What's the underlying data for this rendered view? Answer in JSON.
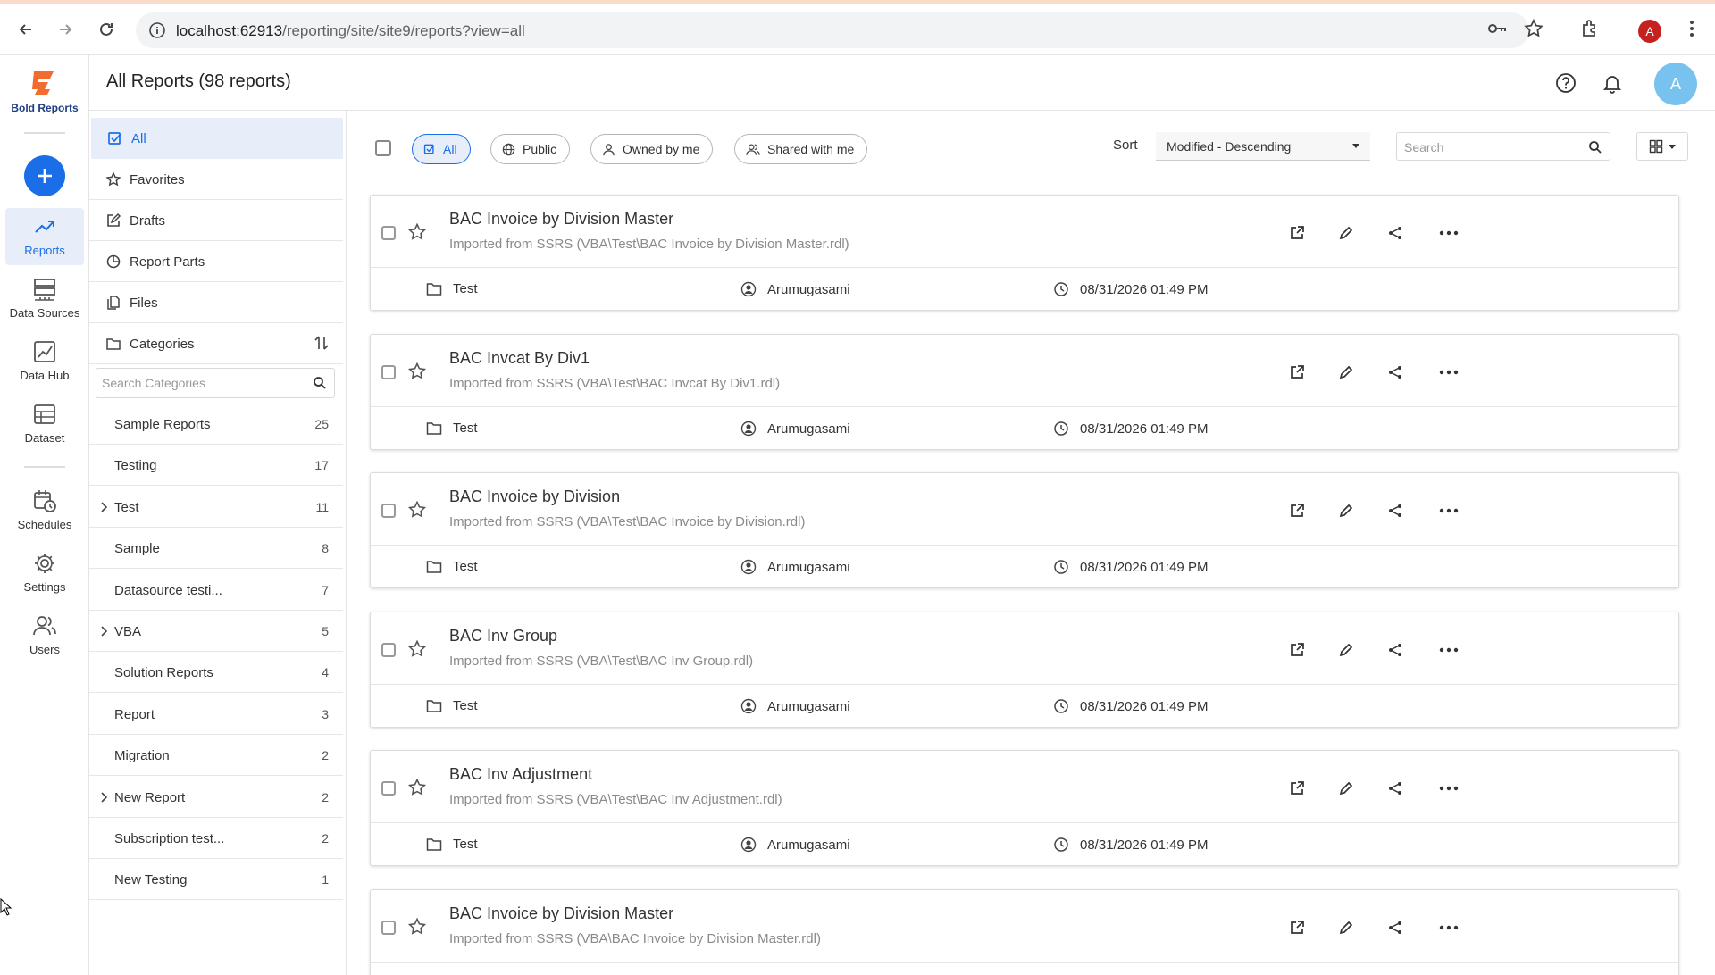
{
  "browser": {
    "url_host": "localhost:62913",
    "url_path": "/reporting/site/site9/reports?view=all",
    "profile_initial": "A"
  },
  "brand": {
    "name": "Bold Reports"
  },
  "rail": {
    "items": [
      {
        "label": "Reports",
        "icon": "trending-up-icon"
      },
      {
        "label": "Data Sources",
        "icon": "server-stack-icon"
      },
      {
        "label": "Data Hub",
        "icon": "chart-box-icon"
      },
      {
        "label": "Dataset",
        "icon": "table-icon"
      },
      {
        "label": "Schedules",
        "icon": "calendar-clock-icon"
      },
      {
        "label": "Settings",
        "icon": "gear-icon"
      },
      {
        "label": "Users",
        "icon": "users-icon"
      }
    ]
  },
  "header": {
    "title": "All Reports (98 reports)",
    "avatar_initial": "A"
  },
  "categories": {
    "nav": [
      {
        "label": "All"
      },
      {
        "label": "Favorites"
      },
      {
        "label": "Drafts"
      },
      {
        "label": "Report Parts"
      },
      {
        "label": "Files"
      },
      {
        "label": "Categories"
      }
    ],
    "search_placeholder": "Search Categories",
    "items": [
      {
        "name": "Sample Reports",
        "count": "25",
        "expandable": false
      },
      {
        "name": "Testing",
        "count": "17",
        "expandable": false
      },
      {
        "name": "Test",
        "count": "11",
        "expandable": true
      },
      {
        "name": "Sample",
        "count": "8",
        "expandable": false
      },
      {
        "name": "Datasource testi...",
        "count": "7",
        "expandable": false
      },
      {
        "name": "VBA",
        "count": "5",
        "expandable": true
      },
      {
        "name": "Solution Reports",
        "count": "4",
        "expandable": false
      },
      {
        "name": "Report",
        "count": "3",
        "expandable": false
      },
      {
        "name": "Migration",
        "count": "2",
        "expandable": false
      },
      {
        "name": "New Report",
        "count": "2",
        "expandable": true
      },
      {
        "name": "Subscription test...",
        "count": "2",
        "expandable": false
      },
      {
        "name": "New Testing",
        "count": "1",
        "expandable": false
      }
    ]
  },
  "toolbar": {
    "filters": [
      "All",
      "Public",
      "Owned by me",
      "Shared with me"
    ],
    "sort_label": "Sort",
    "sort_value": "Modified - Descending",
    "search_placeholder": "Search"
  },
  "reports": [
    {
      "title": "BAC Invoice by Division Master",
      "subtitle": "Imported from SSRS (VBA\\Test\\BAC Invoice by Division Master.rdl)",
      "category": "Test",
      "owner": "Arumugasami",
      "modified": "08/31/2026 01:49 PM"
    },
    {
      "title": "BAC Invcat By Div1",
      "subtitle": "Imported from SSRS (VBA\\Test\\BAC Invcat By Div1.rdl)",
      "category": "Test",
      "owner": "Arumugasami",
      "modified": "08/31/2026 01:49 PM"
    },
    {
      "title": "BAC Invoice by Division",
      "subtitle": "Imported from SSRS (VBA\\Test\\BAC Invoice by Division.rdl)",
      "category": "Test",
      "owner": "Arumugasami",
      "modified": "08/31/2026 01:49 PM"
    },
    {
      "title": "BAC Inv Group",
      "subtitle": "Imported from SSRS (VBA\\Test\\BAC Inv Group.rdl)",
      "category": "Test",
      "owner": "Arumugasami",
      "modified": "08/31/2026 01:49 PM"
    },
    {
      "title": "BAC Inv Adjustment",
      "subtitle": "Imported from SSRS (VBA\\Test\\BAC Inv Adjustment.rdl)",
      "category": "Test",
      "owner": "Arumugasami",
      "modified": "08/31/2026 01:49 PM"
    },
    {
      "title": "BAC Invoice by Division Master",
      "subtitle": "Imported from SSRS (VBA\\BAC Invoice by Division Master.rdl)",
      "category": "",
      "owner": "",
      "modified": ""
    }
  ]
}
